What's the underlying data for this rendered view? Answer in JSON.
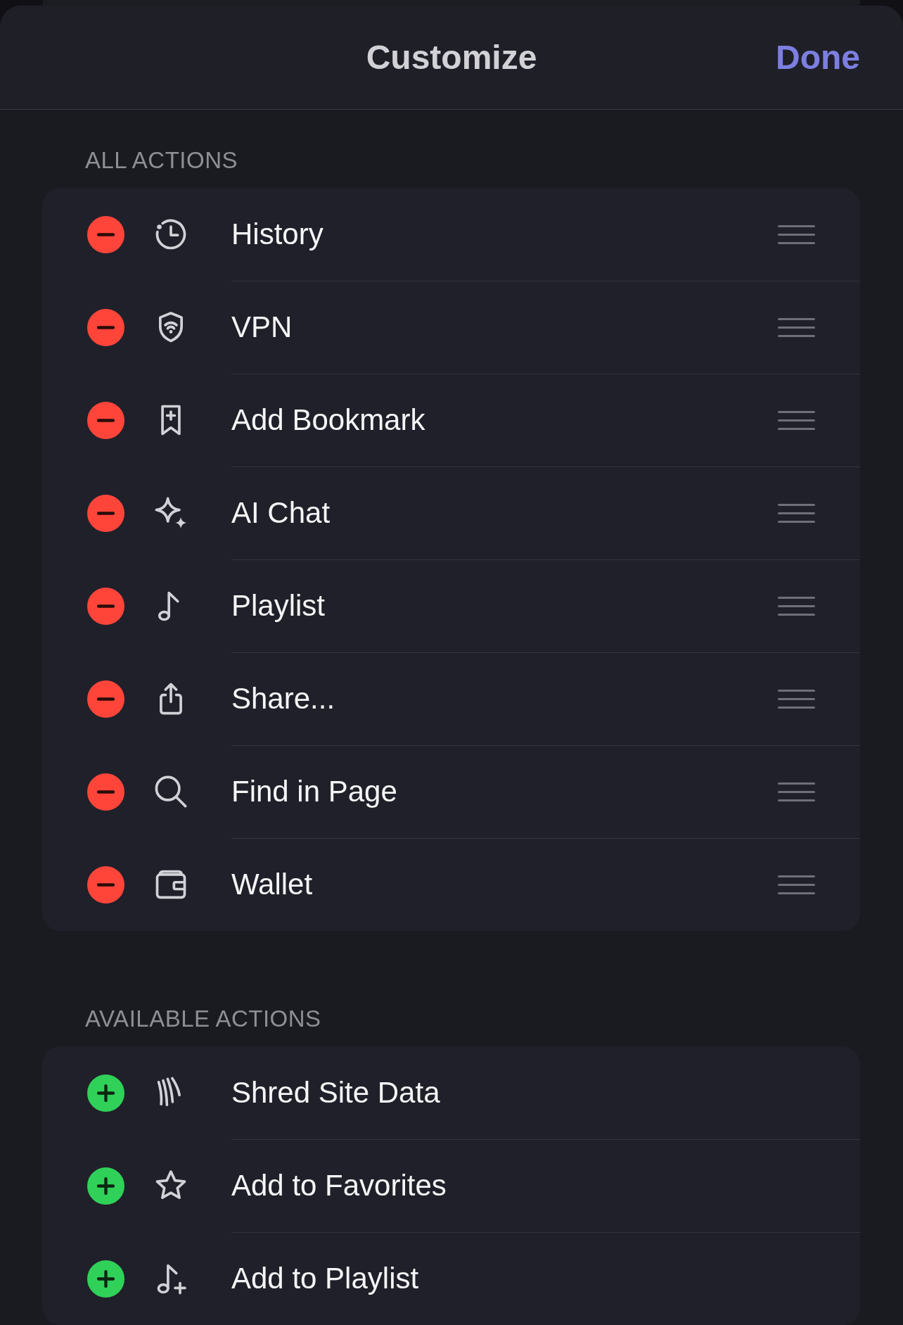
{
  "header": {
    "title": "Customize",
    "done_button": "Done"
  },
  "all_actions": {
    "heading": "ALL ACTIONS",
    "items": [
      "History",
      "VPN",
      "Add Bookmark",
      "AI Chat",
      "Playlist",
      "Share...",
      "Find in Page",
      "Wallet"
    ]
  },
  "available_actions": {
    "heading": "AVAILABLE ACTIONS",
    "items": [
      "Shred Site Data",
      "Add to Favorites",
      "Add to Playlist"
    ]
  }
}
